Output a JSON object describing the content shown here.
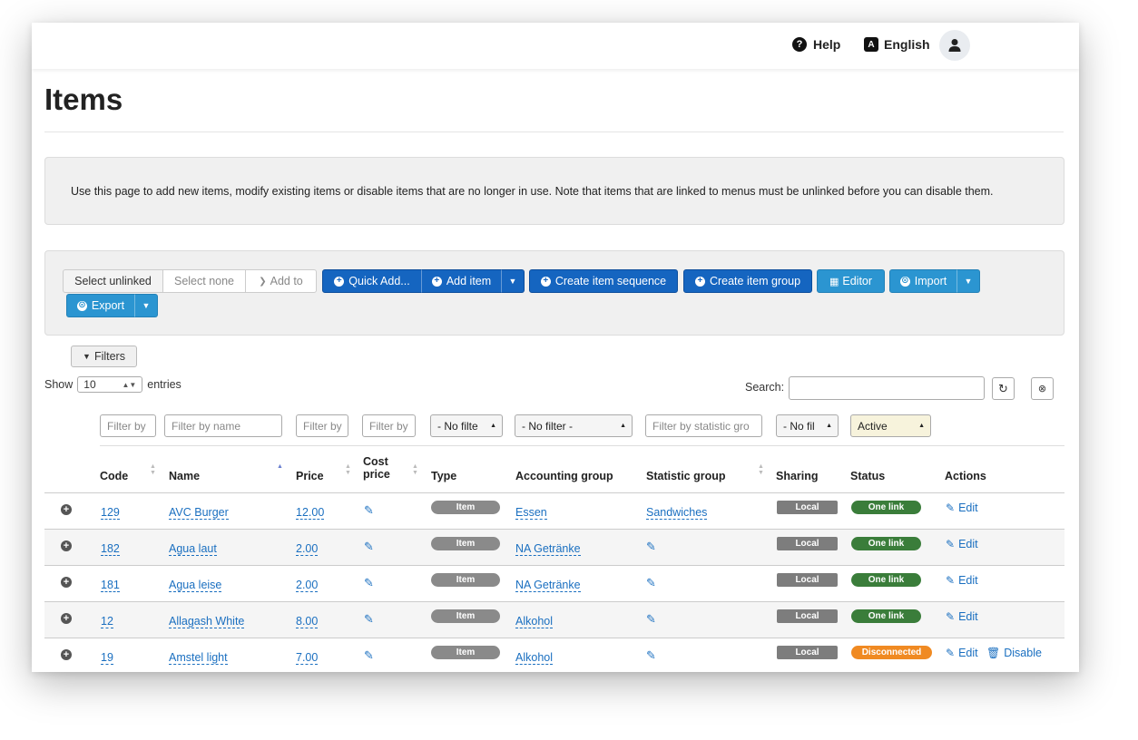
{
  "topbar": {
    "help": "Help",
    "language": "English"
  },
  "page": {
    "title": "Items",
    "info": "Use this page to add new items, modify existing items or disable items that are no longer in use. Note that items that are linked to menus must be unlinked before you can disable them."
  },
  "toolbar": {
    "select_unlinked": "Select unlinked",
    "select_none": "Select none",
    "add_to": "Add to",
    "quick_add": "Quick Add...",
    "add_item": "Add item",
    "create_sequence": "Create item sequence",
    "create_group": "Create item group",
    "editor": "Editor",
    "import": "Import",
    "export": "Export"
  },
  "filters_button": "Filters",
  "show": {
    "prefix": "Show",
    "value": "10",
    "suffix": "entries"
  },
  "search": {
    "label": "Search:"
  },
  "column_filters": {
    "code": "Filter by",
    "name": "Filter by name",
    "price": "Filter by",
    "cost": "Filter by",
    "type": "- No filte",
    "accounting": "- No filter -",
    "statistic": "Filter by statistic gro",
    "sharing": "- No fil",
    "status": "Active"
  },
  "columns": {
    "code": "Code",
    "name": "Name",
    "price": "Price",
    "cost_line1": "Cost",
    "cost_line2": "price",
    "type": "Type",
    "accounting": "Accounting group",
    "statistic": "Statistic group",
    "sharing": "Sharing",
    "status": "Status",
    "actions": "Actions"
  },
  "rows": [
    {
      "code": "129",
      "name": "AVC Burger",
      "price": "12.00",
      "type": "Item",
      "accounting": "Essen",
      "statistic": "Sandwiches",
      "sharing": "Local",
      "status": "One link",
      "edit": "Edit",
      "disable": ""
    },
    {
      "code": "182",
      "name": "Agua laut",
      "price": "2.00",
      "type": "Item",
      "accounting": "NA Getränke",
      "statistic": "",
      "sharing": "Local",
      "status": "One link",
      "edit": "Edit",
      "disable": ""
    },
    {
      "code": "181",
      "name": "Agua leise",
      "price": "2.00",
      "type": "Item",
      "accounting": "NA Getränke",
      "statistic": "",
      "sharing": "Local",
      "status": "One link",
      "edit": "Edit",
      "disable": ""
    },
    {
      "code": "12",
      "name": "Allagash White",
      "price": "8.00",
      "type": "Item",
      "accounting": "Alkohol",
      "statistic": "",
      "sharing": "Local",
      "status": "One link",
      "edit": "Edit",
      "disable": ""
    },
    {
      "code": "19",
      "name": "Amstel light",
      "price": "7.00",
      "type": "Item",
      "accounting": "Alkohol",
      "statistic": "",
      "sharing": "Local",
      "status": "Disconnected",
      "edit": "Edit",
      "disable": "Disable"
    }
  ],
  "colors": {
    "primary": "#1565c0",
    "teal": "#2b95d1",
    "link": "#1a6fc0",
    "one_link": "#3a7d3a",
    "disconnected": "#f08a22"
  }
}
